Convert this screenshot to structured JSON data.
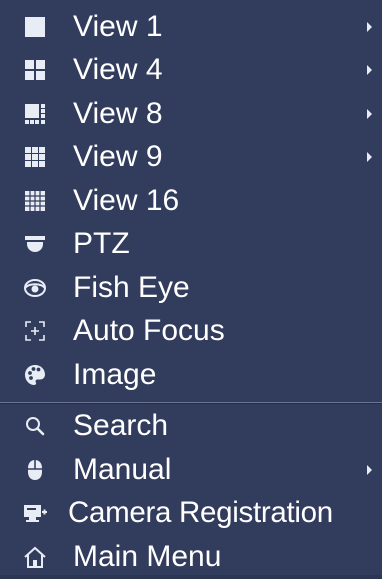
{
  "menu": {
    "view_items": [
      {
        "label": "View 1",
        "icon": "view-1-icon",
        "submenu": true
      },
      {
        "label": "View 4",
        "icon": "view-4-icon",
        "submenu": true
      },
      {
        "label": "View 8",
        "icon": "view-8-icon",
        "submenu": true
      },
      {
        "label": "View 9",
        "icon": "view-9-icon",
        "submenu": true
      },
      {
        "label": "View 16",
        "icon": "view-16-icon",
        "submenu": false
      },
      {
        "label": "PTZ",
        "icon": "ptz-camera-icon",
        "submenu": false
      },
      {
        "label": "Fish Eye",
        "icon": "fish-eye-icon",
        "submenu": false
      },
      {
        "label": "Auto Focus",
        "icon": "auto-focus-icon",
        "submenu": false
      },
      {
        "label": "Image",
        "icon": "palette-icon",
        "submenu": false
      }
    ],
    "tool_items": [
      {
        "label": "Search",
        "icon": "search-icon",
        "submenu": false
      },
      {
        "label": "Manual",
        "icon": "mouse-icon",
        "submenu": true
      },
      {
        "label": "Camera Registration",
        "icon": "camera-registration-icon",
        "submenu": false
      },
      {
        "label": "Main Menu",
        "icon": "home-icon",
        "submenu": false
      }
    ]
  },
  "colors": {
    "background": "#323c5d",
    "text": "#ffffff",
    "icon": "#e8ecf4",
    "divider": "#6c7593"
  }
}
